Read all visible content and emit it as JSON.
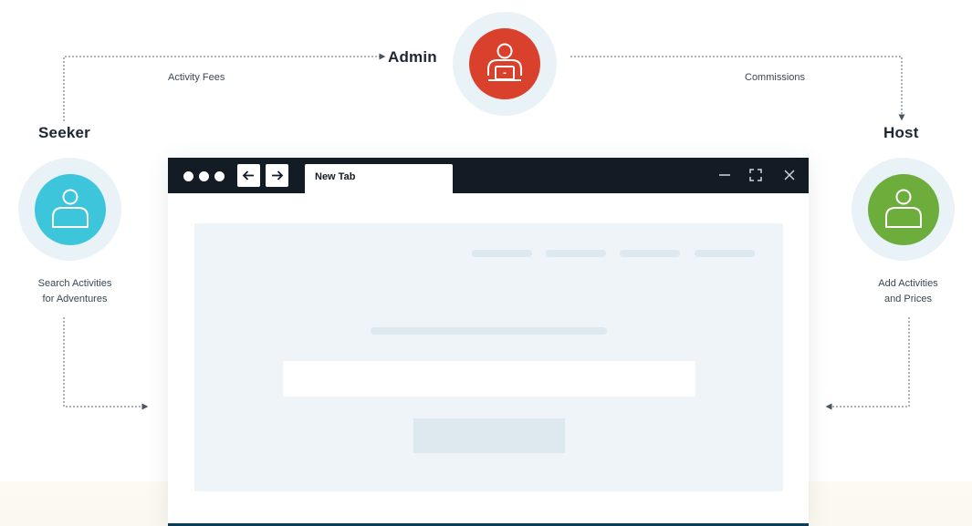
{
  "roles": {
    "admin": {
      "title": "Admin",
      "color": "#d9412c",
      "icon": "admin-laptop-user-icon"
    },
    "seeker": {
      "title": "Seeker",
      "color": "#3dc5dc",
      "icon": "user-icon",
      "caption_line1": "Search Activities",
      "caption_line2": "for Adventures"
    },
    "host": {
      "title": "Host",
      "color": "#6cad3c",
      "icon": "user-icon",
      "caption_line1": "Add Activities",
      "caption_line2": "and Prices"
    }
  },
  "edges": {
    "seeker_to_admin": "Activity Fees",
    "admin_to_host": "Commissions"
  },
  "browser": {
    "tab_label": "New Tab",
    "back_icon": "arrow-left-icon",
    "forward_icon": "arrow-right-icon",
    "window_controls": [
      "minimize-icon",
      "maximize-icon",
      "close-icon"
    ],
    "titlebar_color": "#131c24"
  }
}
